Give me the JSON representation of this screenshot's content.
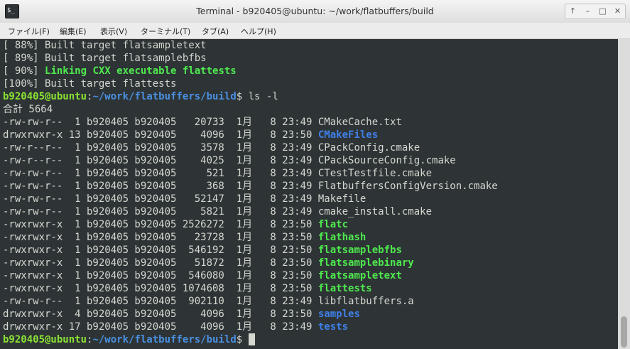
{
  "window": {
    "title": "Terminal - b920405@ubuntu: ~/work/flatbuffers/build",
    "icon_label": "$_",
    "controls": {
      "pin": "↑",
      "minimize": "–",
      "maximize": "□",
      "close": "✕"
    }
  },
  "menu": [
    "ファイル(F)",
    "編集(E)",
    "表示(V)",
    "ターミナル(T)",
    "タブ(A)",
    "ヘルプ(H)"
  ],
  "terminal": {
    "build_lines": [
      "[ 88%] Built target flatsampletext",
      "[ 89%] Built target flatsamplebfbs"
    ],
    "link_prefix": "[ 90%] ",
    "link_text": "Linking CXX executable flattests",
    "built_last": "[100%] Built target flattests",
    "prompt_user": "b920405@ubuntu",
    "prompt_colon": ":",
    "prompt_path": "~/work/flatbuffers/build",
    "prompt_dollar": "$",
    "command": " ls -l",
    "total": "合計 5664",
    "listing": [
      {
        "meta": "-rw-rw-r--  1 b920405 b920405   20733  1月   8 23:49 ",
        "name": "CMakeCache.txt",
        "type": "file"
      },
      {
        "meta": "drwxrwxr-x 13 b920405 b920405    4096  1月   8 23:50 ",
        "name": "CMakeFiles",
        "type": "dir"
      },
      {
        "meta": "-rw-r--r--  1 b920405 b920405    3578  1月   8 23:49 ",
        "name": "CPackConfig.cmake",
        "type": "file"
      },
      {
        "meta": "-rw-r--r--  1 b920405 b920405    4025  1月   8 23:49 ",
        "name": "CPackSourceConfig.cmake",
        "type": "file"
      },
      {
        "meta": "-rw-rw-r--  1 b920405 b920405     521  1月   8 23:49 ",
        "name": "CTestTestfile.cmake",
        "type": "file"
      },
      {
        "meta": "-rw-rw-r--  1 b920405 b920405     368  1月   8 23:49 ",
        "name": "FlatbuffersConfigVersion.cmake",
        "type": "file"
      },
      {
        "meta": "-rw-rw-r--  1 b920405 b920405   52147  1月   8 23:49 ",
        "name": "Makefile",
        "type": "file"
      },
      {
        "meta": "-rw-rw-r--  1 b920405 b920405    5821  1月   8 23:49 ",
        "name": "cmake_install.cmake",
        "type": "file"
      },
      {
        "meta": "-rwxrwxr-x  1 b920405 b920405 2526272  1月   8 23:50 ",
        "name": "flatc",
        "type": "exec"
      },
      {
        "meta": "-rwxrwxr-x  1 b920405 b920405   23728  1月   8 23:50 ",
        "name": "flathash",
        "type": "exec"
      },
      {
        "meta": "-rwxrwxr-x  1 b920405 b920405  546192  1月   8 23:50 ",
        "name": "flatsamplebfbs",
        "type": "exec"
      },
      {
        "meta": "-rwxrwxr-x  1 b920405 b920405   51872  1月   8 23:50 ",
        "name": "flatsamplebinary",
        "type": "exec"
      },
      {
        "meta": "-rwxrwxr-x  1 b920405 b920405  546080  1月   8 23:50 ",
        "name": "flatsampletext",
        "type": "exec"
      },
      {
        "meta": "-rwxrwxr-x  1 b920405 b920405 1074608  1月   8 23:50 ",
        "name": "flattests",
        "type": "exec"
      },
      {
        "meta": "-rw-rw-r--  1 b920405 b920405  902110  1月   8 23:49 ",
        "name": "libflatbuffers.a",
        "type": "file"
      },
      {
        "meta": "drwxrwxr-x  4 b920405 b920405    4096  1月   8 23:50 ",
        "name": "samples",
        "type": "dir"
      },
      {
        "meta": "drwxrwxr-x 17 b920405 b920405    4096  1月   8 23:49 ",
        "name": "tests",
        "type": "dir"
      }
    ]
  },
  "colors": {
    "terminal_bg": "#2e3436",
    "terminal_fg": "#d3d7cf",
    "prompt_green": "#8ae234",
    "path_blue": "#4a90e2",
    "exec_green": "#4ee94e",
    "dir_blue": "#3f7fe6"
  },
  "scrollbar": {
    "position_fraction": 1.0
  }
}
